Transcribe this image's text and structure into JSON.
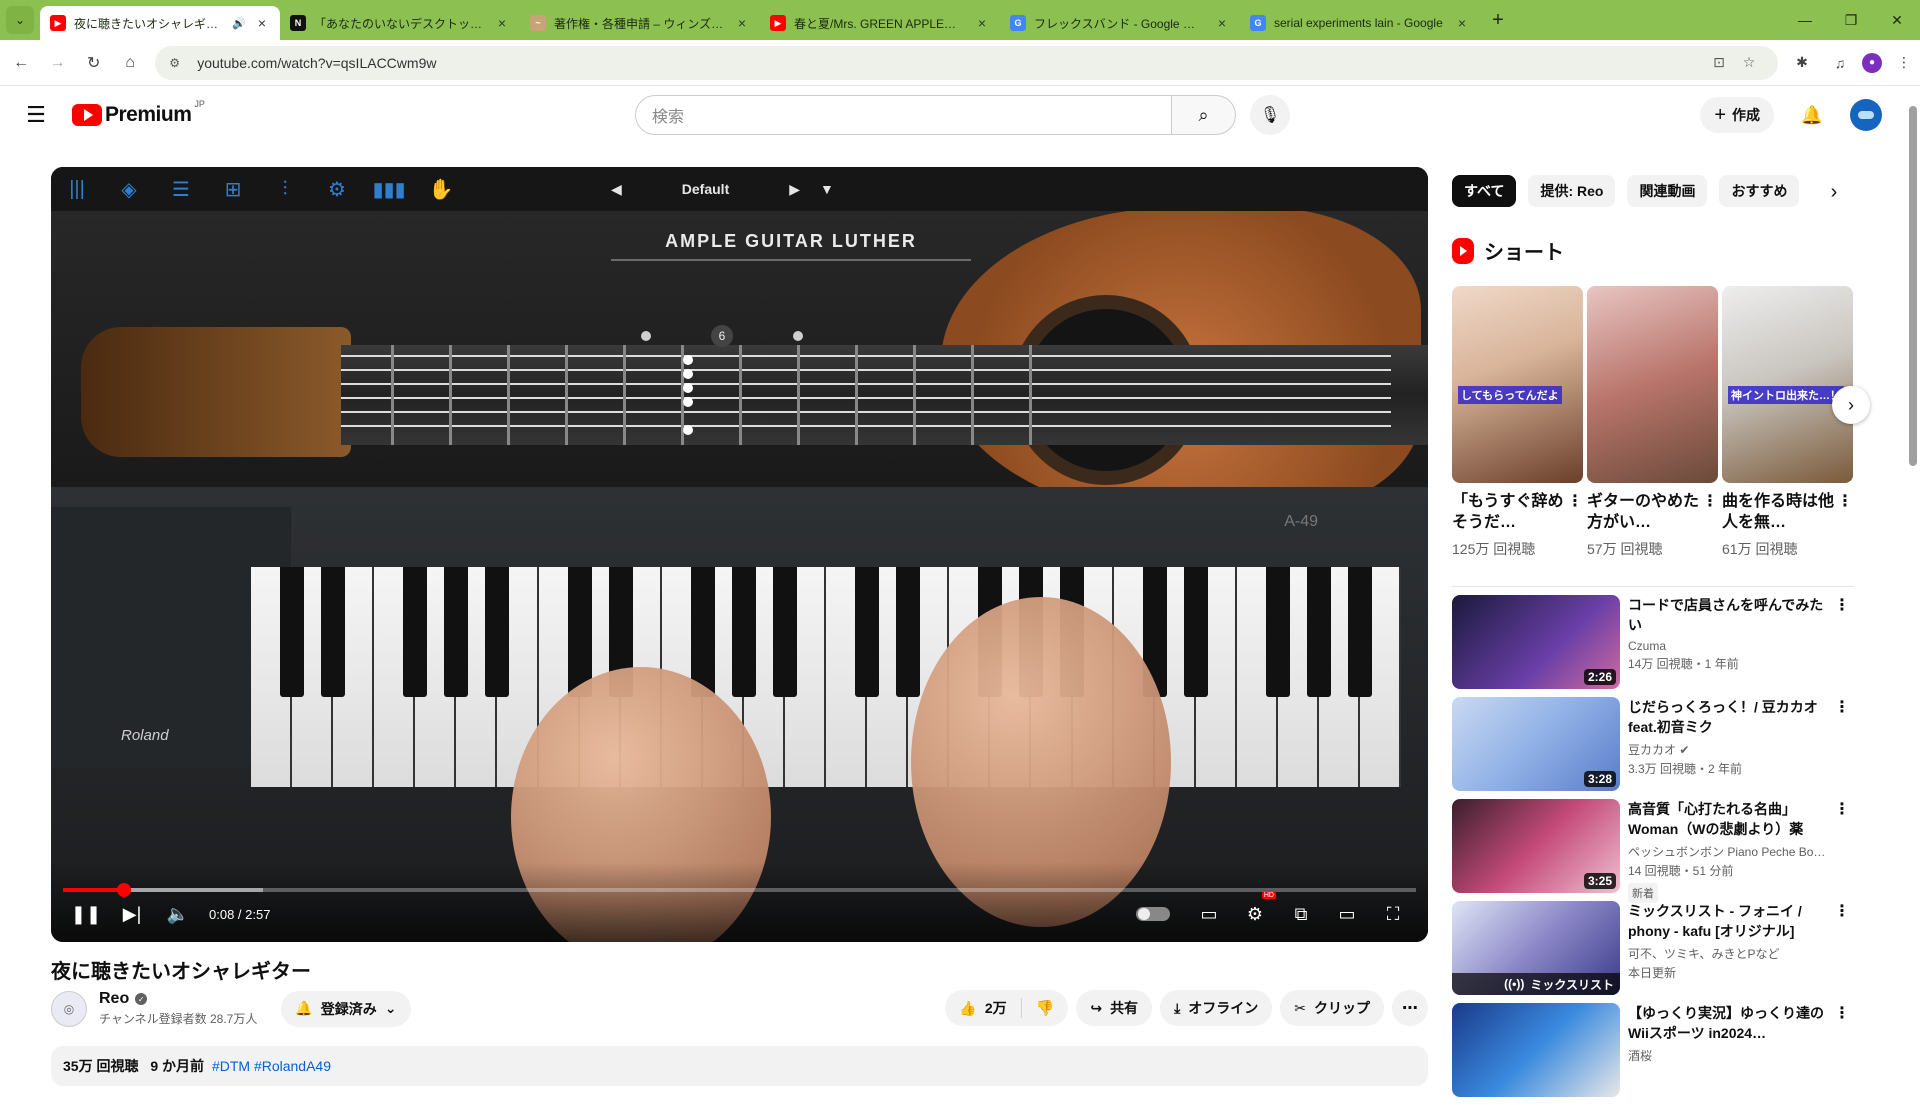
{
  "browser": {
    "tabs": [
      {
        "title": "夜に聴きたいオシャレギター - Yo",
        "favicon": "youtube",
        "active": true,
        "audio": true
      },
      {
        "title": "「あなたのいないデスクトップ」につい",
        "favicon": "notion",
        "active": false
      },
      {
        "title": "著作権・各種申請 – ウィンズスコア",
        "favicon": "winds",
        "active": false
      },
      {
        "title": "春と夏/Mrs. GREEN APPLE【大阪",
        "favicon": "youtube",
        "active": false
      },
      {
        "title": "フレックスバンド - Google 検索",
        "favicon": "google",
        "active": false
      },
      {
        "title": "serial experiments lain - Google",
        "favicon": "google",
        "active": false
      }
    ],
    "url": "youtube.com/watch?v=qsILACCwm9w"
  },
  "masthead": {
    "logo_text": "Premium",
    "region": "JP",
    "search_placeholder": "検索",
    "create_label": "作成"
  },
  "player": {
    "plugin_preset": "Default",
    "plugin_brand": "AMPLE GUITAR LUTHER",
    "fret_marker": "6",
    "keyboard_brand": "Roland",
    "keyboard_model": "A-49",
    "time_current": "0:08",
    "time_total": "2:57",
    "progress_fraction": 0.0452,
    "hd_badge": "HD"
  },
  "video": {
    "title": "夜に聴きたいオシャレギター",
    "channel": "Reo",
    "subscribers": "チャンネル登録者数 28.7万人",
    "subscribe_label": "登録済み",
    "likes": "2万",
    "share_label": "共有",
    "offline_label": "オフライン",
    "clip_label": "クリップ",
    "views": "35万 回視聴",
    "age": "9 か月前",
    "hashtags": "#DTM #RolandA49"
  },
  "chips": [
    "すべて",
    "提供: Reo",
    "関連動画",
    "おすすめ"
  ],
  "shorts": {
    "heading": "ショート",
    "items": [
      {
        "title": "「もうすぐ辞めそうだ…",
        "views": "125万 回視聴",
        "caption": "してもらってんだよ"
      },
      {
        "title": "ギターのやめた方がい…",
        "views": "57万 回視聴",
        "caption": ""
      },
      {
        "title": "曲を作る時は他人を無…",
        "views": "61万 回視聴",
        "caption": "神イントロ出来た…！"
      }
    ]
  },
  "recommendations": [
    {
      "title": "コードで店員さんを呼んでみたい",
      "channel": "Czuma",
      "meta": "14万 回視聴・1 年前",
      "duration": "2:26",
      "verified": false,
      "badge": ""
    },
    {
      "title": "じだらっくろっく！/ 豆カカオ feat.初音ミク",
      "channel": "豆カカオ",
      "meta": "3.3万 回視聴・2 年前",
      "duration": "3:28",
      "verified": true,
      "badge": ""
    },
    {
      "title": "高音質「心打たれる名曲」Woman（Wの悲劇より）薬師…",
      "channel": "ペッシュボンボン Piano Peche Bonbons…",
      "meta": "14 回視聴・51 分前",
      "duration": "3:25",
      "verified": false,
      "badge": "新着"
    },
    {
      "title": "ミックスリスト - フォニイ / phony - kafu [オリジナル]",
      "channel": "可不、ツミキ、みきとPなど",
      "meta": "本日更新",
      "duration": "",
      "verified": false,
      "badge": "",
      "mix_label": "ミックスリスト"
    },
    {
      "title": "【ゆっくり実況】ゆっくり達のWiiスポーツ in2024…",
      "channel": "酒桜",
      "meta": "",
      "duration": "",
      "verified": false,
      "badge": ""
    }
  ],
  "colors": {
    "tabbar": "#8cc152",
    "yt_red": "#ff0000",
    "plugin_blue": "#2f7fcf",
    "link_blue": "#065fd4"
  }
}
